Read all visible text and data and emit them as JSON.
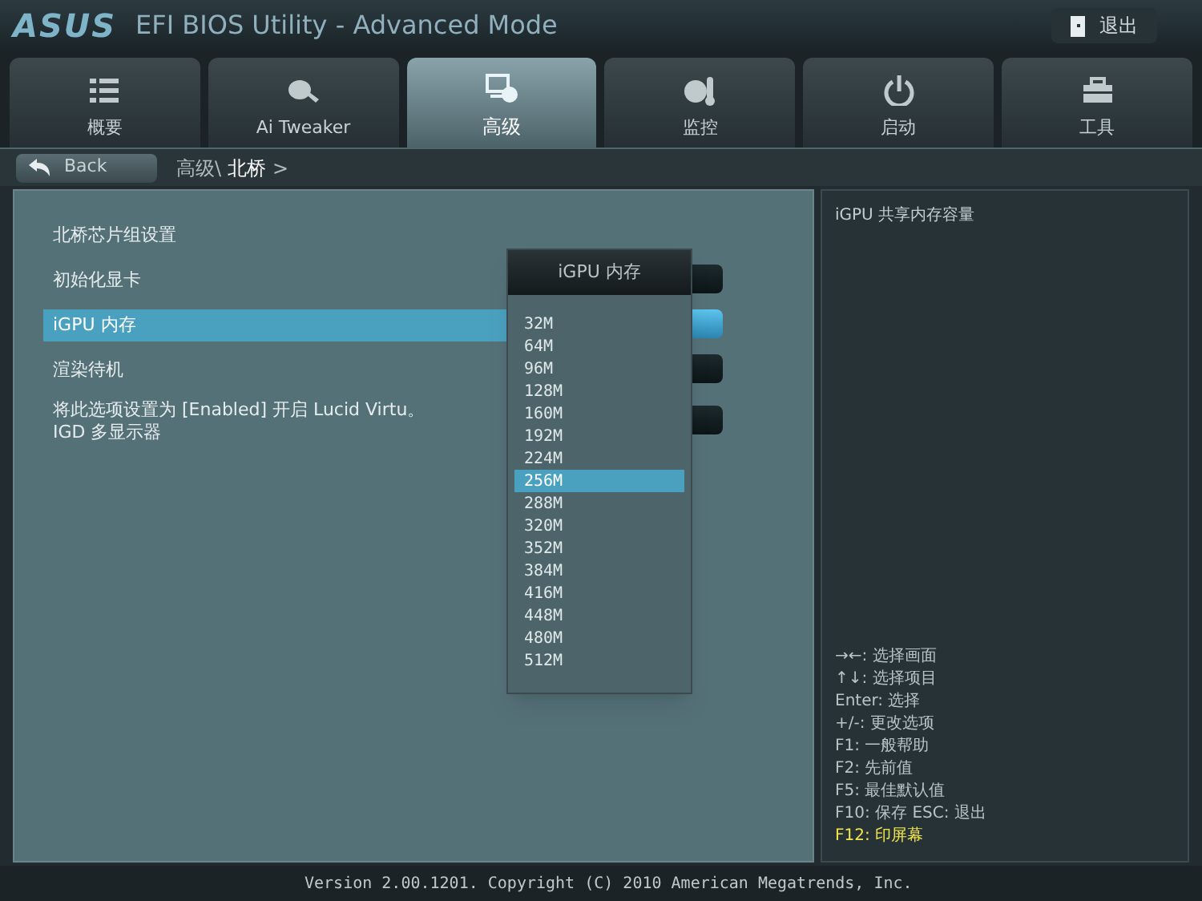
{
  "window": {
    "logo": "ASUS",
    "title": "EFI BIOS Utility - Advanced Mode",
    "exit_button": "退出"
  },
  "tabs": [
    {
      "label": "概要",
      "selected": false
    },
    {
      "label": "Ai Tweaker",
      "selected": false
    },
    {
      "label": "高级",
      "selected": true
    },
    {
      "label": "监控",
      "selected": false
    },
    {
      "label": "启动",
      "selected": false
    },
    {
      "label": "工具",
      "selected": false
    }
  ],
  "back_button": "Back",
  "breadcrumb": [
    "高级\\",
    "北桥",
    ">"
  ],
  "settings": [
    {
      "kind": "heading",
      "label": "北桥芯片组设置",
      "selected": false
    },
    {
      "kind": "item",
      "label": "初始化显卡",
      "selected": false
    },
    {
      "kind": "item",
      "label": "iGPU 内存",
      "selected": true
    },
    {
      "kind": "item",
      "label": "渲染待机",
      "selected": false
    },
    {
      "kind": "note",
      "label": "将此选项设置为 [Enabled] 开启 Lucid Virtu。\nIGD 多显示器",
      "selected": false
    }
  ],
  "popup": {
    "title": "iGPU 内存",
    "options": [
      {
        "label": "32M",
        "selected": false
      },
      {
        "label": "64M",
        "selected": false
      },
      {
        "label": "96M",
        "selected": false
      },
      {
        "label": "128M",
        "selected": false
      },
      {
        "label": "160M",
        "selected": false
      },
      {
        "label": "192M",
        "selected": false
      },
      {
        "label": "224M",
        "selected": false
      },
      {
        "label": "256M",
        "selected": true
      },
      {
        "label": "288M",
        "selected": false
      },
      {
        "label": "320M",
        "selected": false
      },
      {
        "label": "352M",
        "selected": false
      },
      {
        "label": "384M",
        "selected": false
      },
      {
        "label": "416M",
        "selected": false
      },
      {
        "label": "448M",
        "selected": false
      },
      {
        "label": "480M",
        "selected": false
      },
      {
        "label": "512M",
        "selected": false
      }
    ]
  },
  "help_text": "iGPU 共享内存容量",
  "key_help": [
    {
      "text": "→←: 选择画面",
      "highlight": false
    },
    {
      "text": "↑↓: 选择项目",
      "highlight": false
    },
    {
      "text": "Enter: 选择",
      "highlight": false
    },
    {
      "text": "+/-: 更改选项",
      "highlight": false
    },
    {
      "text": "F1: 一般帮助",
      "highlight": false
    },
    {
      "text": "F2: 先前值",
      "highlight": false
    },
    {
      "text": "F5: 最佳默认值",
      "highlight": false
    },
    {
      "text": "F10: 保存  ESC: 退出",
      "highlight": false
    },
    {
      "text": "F12: 印屏幕",
      "highlight": true
    }
  ],
  "status_bar": "Version 2.00.1201. Copyright (C) 2010 American Megatrends, Inc."
}
